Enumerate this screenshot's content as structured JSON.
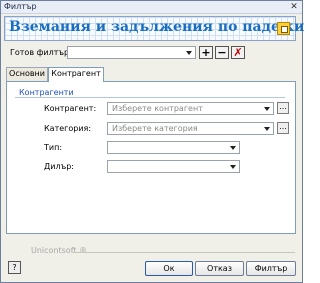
{
  "window": {
    "title": "Филтър",
    "close_glyph": "✕"
  },
  "header": {
    "title": "Вземания и задължения по падежи",
    "icon": "form-settings-icon",
    "title_color": "#1a6ec1"
  },
  "preset": {
    "label": "Готов филтър:",
    "value": "",
    "add_glyph": "+",
    "remove_glyph": "−",
    "delete_glyph": "✗"
  },
  "tabs": [
    {
      "label": "Основни",
      "active": false
    },
    {
      "label": "Контрагент",
      "active": true
    }
  ],
  "contragent_group": {
    "title": "Контрагенти",
    "fields": [
      {
        "label": "Контрагент:",
        "placeholder": "Изберете контрагент",
        "has_browse": true
      },
      {
        "label": "Категория:",
        "placeholder": "Изберете категория",
        "has_browse": true
      },
      {
        "label": "Тип:",
        "placeholder": "",
        "has_browse": false
      },
      {
        "label": "Дилър:",
        "placeholder": "",
        "has_browse": false
      }
    ],
    "browse_glyph": "..."
  },
  "footer": {
    "brand": "Unicontsoft ®",
    "help_glyph": "?",
    "buttons": {
      "ok": "Ок",
      "cancel": "Отказ",
      "filter": "Филтър"
    }
  }
}
